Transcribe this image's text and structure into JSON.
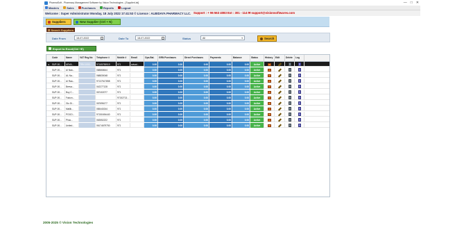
{
  "window": {
    "title": "PharmaSoft - Pharmacy Management Software by Vision Technologies - [SupplierList]"
  },
  "menu": [
    {
      "label": "Masters",
      "icon": "masters-icon",
      "color": "#3a7bd5"
    },
    {
      "label": "Sales",
      "icon": "sales-icon",
      "color": "#e0a020"
    },
    {
      "label": "Purchases",
      "icon": "purchases-icon",
      "color": "#d04020"
    },
    {
      "label": "Reports",
      "icon": "reports-icon",
      "color": "#3aa040"
    },
    {
      "label": "Logout",
      "icon": "logout-icon",
      "color": "#c02020"
    }
  ],
  "welcome": {
    "text": "Welcome : Super Administrator   Monday, 18 July 2022 17:41:53   © Licence : ALBIDAYA PHARMACY LLC.",
    "support": "Support : + 96 563 4083 Ext : 301 - 114  ✉ support@visionsoftwares.com"
  },
  "toolbar": {
    "suppliers_label": "Suppliers",
    "new_supplier_label": "New Supplier (Ctrl + N)"
  },
  "search": {
    "section_title": "Search Suppliers",
    "date_from_label": "Date From",
    "date_from_value": "18-07-2022",
    "date_to_label": "Date To",
    "date_to_value": "18-07-2022",
    "status_label": "Status",
    "status_value": "All",
    "search_button": "Search"
  },
  "export_button": "Export to Excel(Ctrl +E)",
  "grid": {
    "columns": [
      "Code",
      "Name",
      "VAT Reg.No",
      "Telephone #",
      "Mobile #",
      "Email",
      "Ops.Bal.",
      "GRN Purchases",
      "Direct Purchases",
      "Payments",
      "Balance",
      "Status",
      "History",
      "Edit",
      "Delete",
      "Log"
    ],
    "rows": [
      {
        "code": "SUP-00...",
        "name": "ADVA...",
        "vat": "TRN 1000...",
        "tel": "97165755919",
        "mobile": "971",
        "email": "advad...",
        "ops": "0.00",
        "grn": "0.00",
        "direct": "0.00",
        "payments": "0.00",
        "balance": "0.00",
        "status": "Active"
      },
      {
        "code": "SUP-00...",
        "name": "Al Naa...",
        "vat": "",
        "tel": "068868644",
        "mobile": "971",
        "email": "",
        "ops": "0.00",
        "grn": "0.00",
        "direct": "0.00",
        "payments": "0.00",
        "balance": "0.00",
        "status": "Active"
      },
      {
        "code": "SUP-00...",
        "name": "AL Na...",
        "vat": "",
        "tel": "068830048",
        "mobile": "971",
        "email": "",
        "ops": "0.00",
        "grn": "0.00",
        "direct": "0.00",
        "payments": "0.00",
        "balance": "0.00",
        "status": "Active"
      },
      {
        "code": "SUP-00...",
        "name": "Al Raa...",
        "vat": "",
        "tel": "97137617858",
        "mobile": "971",
        "email": "",
        "ops": "0.00",
        "grn": "0.00",
        "direct": "0.00",
        "payments": "0.00",
        "balance": "0.00",
        "status": "Active"
      },
      {
        "code": "SUP-00...",
        "name": "Beeva...",
        "vat": "",
        "tel": "042277128",
        "mobile": "971",
        "email": "",
        "ops": "0.00",
        "grn": "0.00",
        "direct": "0.00",
        "payments": "0.00",
        "balance": "0.00",
        "status": "Active"
      },
      {
        "code": "SUP-00...",
        "name": "Buy C...",
        "vat": "",
        "tel": "067402077",
        "mobile": "971",
        "email": "",
        "ops": "0.00",
        "grn": "0.00",
        "direct": "0.00",
        "payments": "0.00",
        "balance": "0.00",
        "status": "Active"
      },
      {
        "code": "SUP-00...",
        "name": "Falcon...",
        "vat": "",
        "tel": "",
        "mobile": "97152713...",
        "email": "",
        "ops": "0.00",
        "grn": "0.00",
        "direct": "0.00",
        "payments": "0.00",
        "balance": "0.00",
        "status": "Active"
      },
      {
        "code": "SUP-00...",
        "name": "Gio Di...",
        "vat": "",
        "tel": "067696177",
        "mobile": "971",
        "email": "",
        "ops": "0.00",
        "grn": "0.00",
        "direct": "0.00",
        "payments": "0.00",
        "balance": "0.00",
        "status": "Active"
      },
      {
        "code": "SUP-00...",
        "name": "Mallik...",
        "vat": "",
        "tel": "065440244",
        "mobile": "971",
        "email": "",
        "ops": "0.00",
        "grn": "0.00",
        "direct": "0.00",
        "payments": "0.00",
        "balance": "0.00",
        "status": "Active"
      },
      {
        "code": "SUP-00...",
        "name": "POGO...",
        "vat": "",
        "tel": "97150494440",
        "mobile": "971",
        "email": "",
        "ops": "0.00",
        "grn": "0.00",
        "direct": "0.00",
        "payments": "0.00",
        "balance": "0.00",
        "status": "Active"
      },
      {
        "code": "SUP-00...",
        "name": "Phac...",
        "vat": "",
        "tel": "063552222",
        "mobile": "971",
        "email": "",
        "ops": "0.00",
        "grn": "0.00",
        "direct": "0.00",
        "payments": "0.00",
        "balance": "0.00",
        "status": "Active"
      },
      {
        "code": "SUP-00...",
        "name": "United...",
        "vat": "",
        "tel": "06174679750",
        "mobile": "971",
        "email": "",
        "ops": "0.00",
        "grn": "0.00",
        "direct": "0.00",
        "payments": "0.00",
        "balance": "0.00",
        "status": "Active"
      }
    ]
  },
  "footer": "2005-2025 © Vision Technologies"
}
